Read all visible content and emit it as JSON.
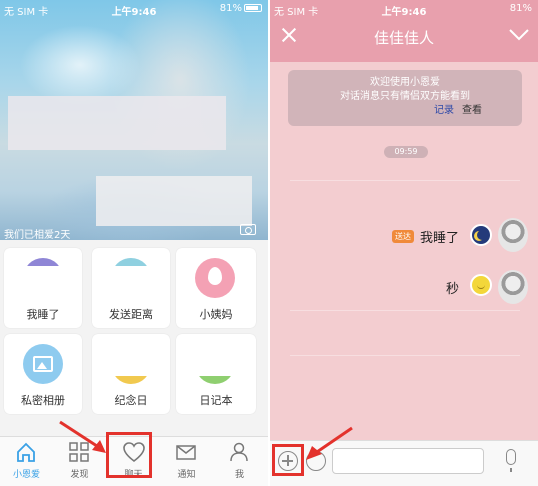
{
  "left": {
    "status": {
      "carrier": "无 SIM 卡",
      "time": "上午9:46",
      "battery": "81%"
    },
    "hero_caption": "我们已相爱2天",
    "tiles": [
      {
        "label": "我睡了",
        "icon": "moon-icon"
      },
      {
        "label": "发送距离",
        "icon": "distance-icon"
      },
      {
        "label": "小姨妈",
        "icon": "drop-icon"
      },
      {
        "label": "私密相册",
        "icon": "photo-icon"
      },
      {
        "label": "纪念日",
        "icon": "calendar-icon"
      },
      {
        "label": "日记本",
        "icon": "diary-icon"
      }
    ],
    "tabs": [
      {
        "label": "小恩爱",
        "icon": "home-icon",
        "active": true
      },
      {
        "label": "发现",
        "icon": "grid-icon",
        "active": false
      },
      {
        "label": "聊天",
        "icon": "heart-icon",
        "active": false
      },
      {
        "label": "通知",
        "icon": "mail-icon",
        "active": false
      },
      {
        "label": "我",
        "icon": "person-icon",
        "active": false
      }
    ]
  },
  "right": {
    "status": {
      "carrier": "无 SIM 卡",
      "time": "上午9:46",
      "battery": "81%"
    },
    "title": "佳佳佳人",
    "notice": {
      "line1": "欢迎使用小恩爱",
      "line2": "对话消息只有情侣双方能看到",
      "link": "记录",
      "view": "查看"
    },
    "time_chip": "09:59",
    "messages": [
      {
        "tag": "送达",
        "text": "我睡了",
        "icon": "moon-icon"
      },
      {
        "text": "秒",
        "icon": "smile-icon"
      }
    ]
  },
  "colors": {
    "header_pink": "#e8a0ad",
    "chat_bg": "#f3cdd0",
    "accent_blue": "#3aa1e6",
    "highlight_red": "#e3322c"
  }
}
